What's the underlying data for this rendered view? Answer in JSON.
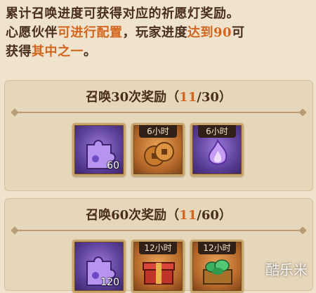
{
  "intro": {
    "p1": "累计召唤进度可获得对应的祈愿灯奖励。",
    "p2a": "心愿伙伴",
    "p2b": "可进行配置",
    "p2c": "，玩家进度",
    "p2d": "达到90",
    "p2e": "可",
    "p3a": "获得",
    "p3b": "其中之一",
    "p3c": "。"
  },
  "tiers": [
    {
      "title": "召唤30次奖励（",
      "current": "11",
      "sep": "/",
      "target": "30",
      "close": "）",
      "items": [
        {
          "icon": "puzzle-piece-icon",
          "quantity": "60"
        },
        {
          "icon": "copper-coins-icon",
          "duration": "6小时"
        },
        {
          "icon": "purple-flame-icon",
          "duration": "6小时"
        }
      ]
    },
    {
      "title": "召唤60次奖励（",
      "current": "11",
      "sep": "/",
      "target": "60",
      "close": "）",
      "items": [
        {
          "icon": "puzzle-piece-icon",
          "quantity": "120"
        },
        {
          "icon": "red-chest-icon",
          "duration": "12小时"
        },
        {
          "icon": "jade-chest-icon",
          "duration": "12小时"
        }
      ]
    }
  ],
  "watermark": "酷乐米",
  "colors": {
    "highlight": "#d2661f",
    "text": "#4a2e1c",
    "background": "#efe3cd"
  }
}
